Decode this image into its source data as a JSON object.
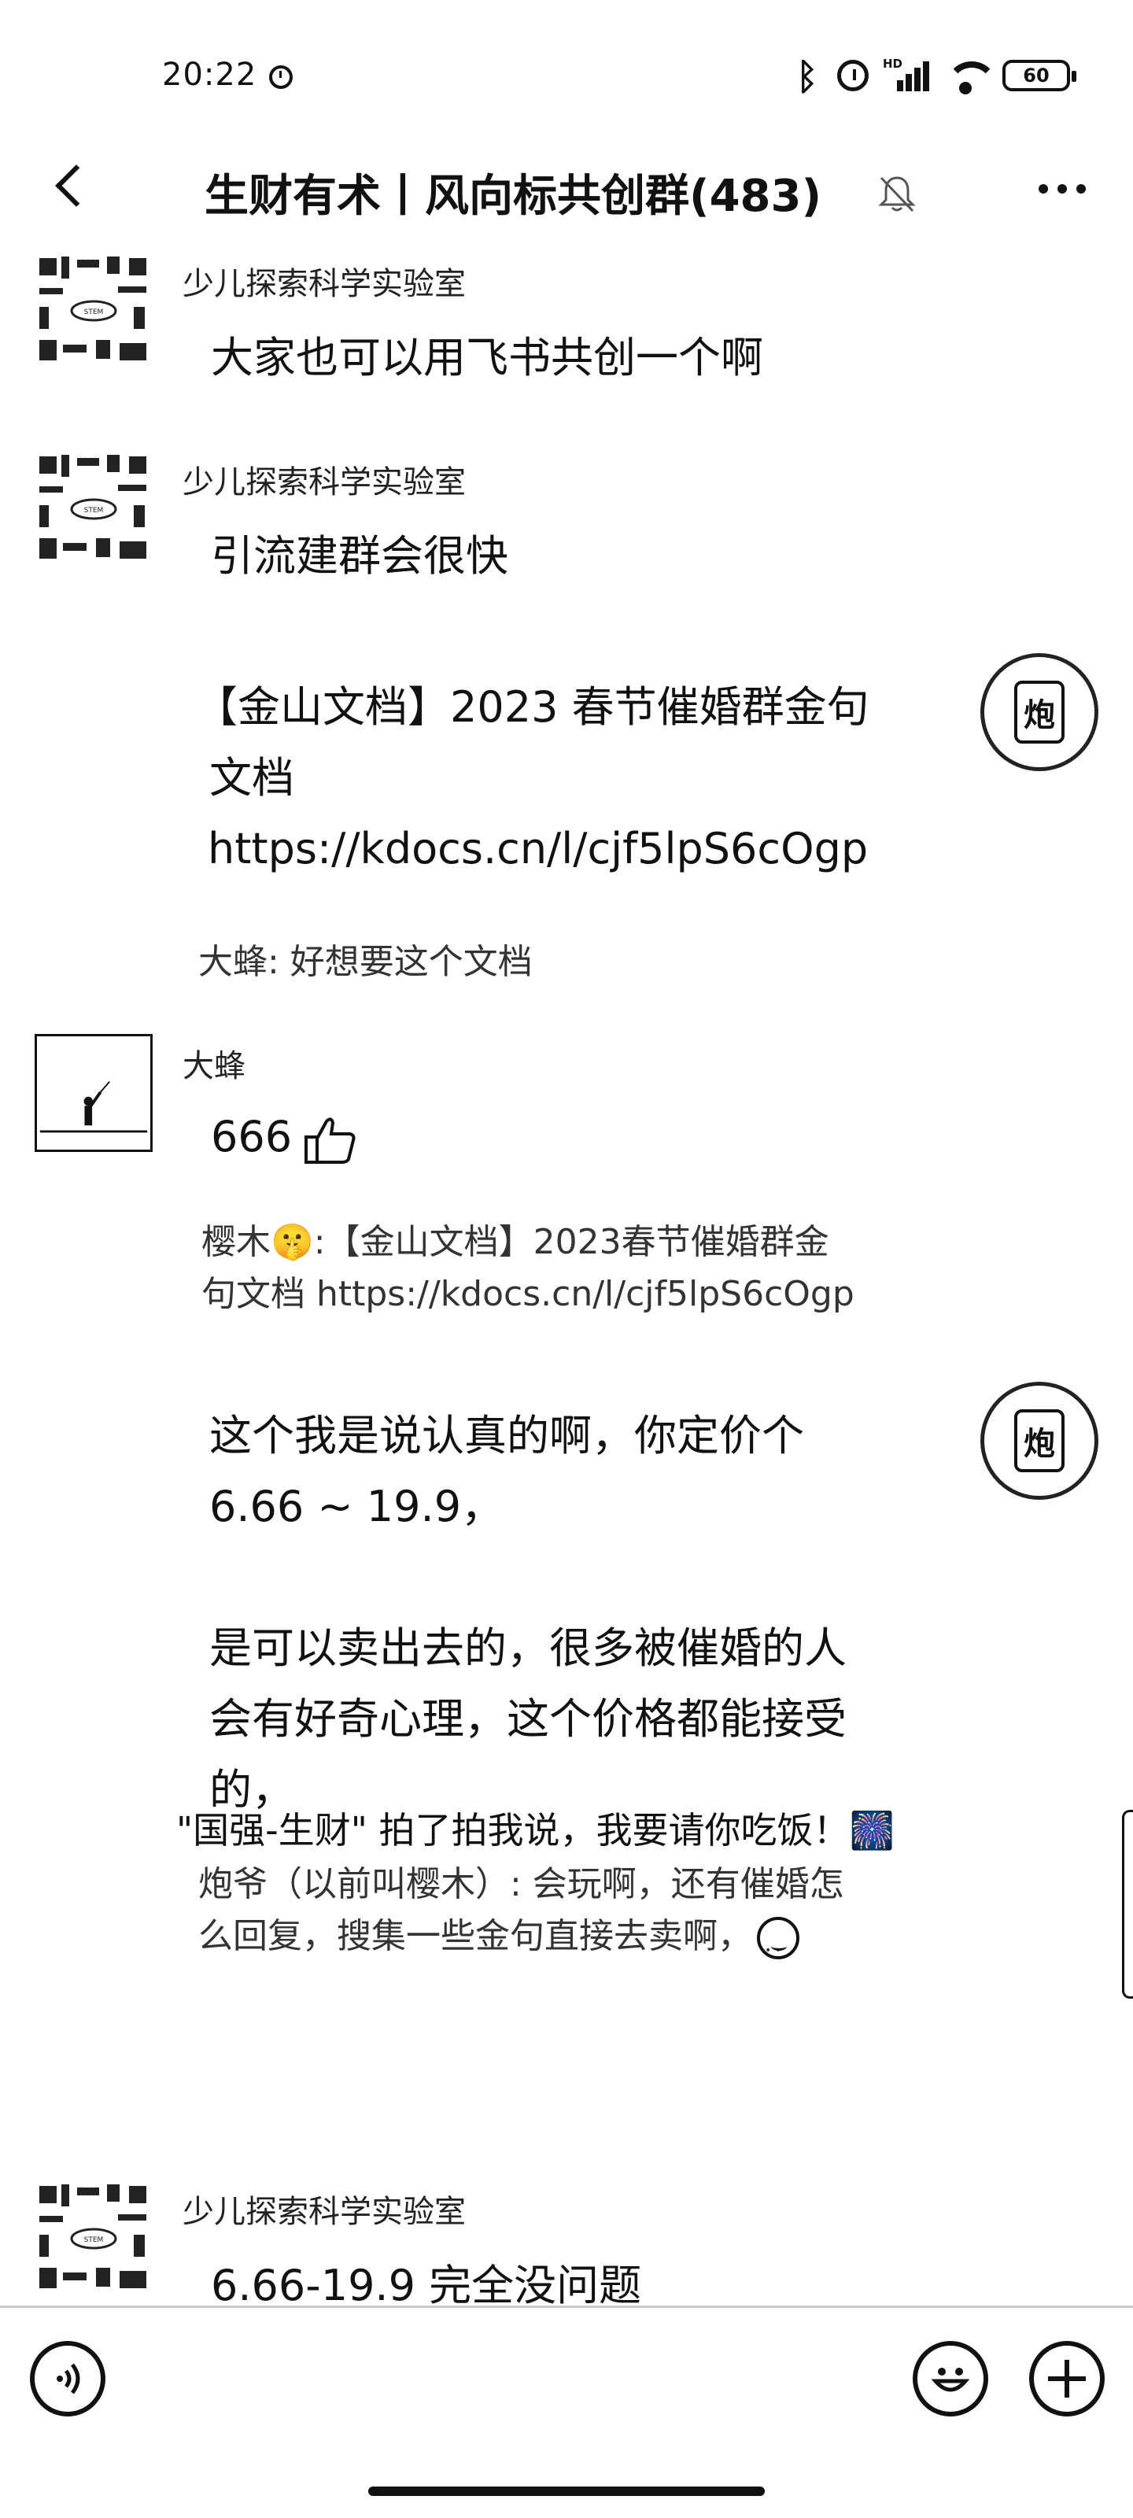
{
  "status_bar": {
    "time": "20:22",
    "battery": "60",
    "signal_label": "HD",
    "icons": [
      "alarm-icon",
      "bluetooth-icon",
      "alarm-clock-icon",
      "signal-icon",
      "wifi-icon",
      "battery-icon"
    ]
  },
  "header": {
    "back_icon": "chevron-left-icon",
    "title": "生财有术丨风向标共创群(483)",
    "mute_icon": "bell-muted-icon",
    "more_icon": "more-horizontal-icon"
  },
  "messages": {
    "m1": {
      "sender": "少儿探索科学实验室",
      "text": "大家也可以用飞书共创一个啊"
    },
    "m2": {
      "sender": "少儿探索科学实验室",
      "text": "引流建群会很快"
    },
    "m3": {
      "lines": [
        "【金山文档】2023 春节催婚群金句",
        "文档",
        "https://kdocs.cn/l/cjf5lpS6cOgp"
      ],
      "quote": "大蜂: 好想要这个文档"
    },
    "m4": {
      "sender": "大蜂",
      "text": "666",
      "quote_lines": [
        "樱木🤫:【金山文档】2023春节催婚群金",
        "句文档 https://kdocs.cn/l/cjf5lpS6cOgp"
      ]
    },
    "m5": {
      "lines": [
        "这个我是说认真的啊，你定价个",
        "6.66 ~ 19.9，",
        "",
        "是可以卖出去的，很多被催婚的人",
        "会有好奇心理，这个价格都能接受",
        "的，"
      ],
      "quote_lines": [
        "炮爷（以前叫樱木）: 会玩啊，还有催婚怎",
        "么回复，搜集一些金句直接去卖啊，"
      ]
    },
    "system": "\"国强-生财\" 拍了拍我说，我要请你吃饭！🎆",
    "m6": {
      "sender": "少儿探索科学实验室",
      "text": "6.66-19.9 完全没问题"
    }
  },
  "pao_avatar_char": "炮",
  "input_bar": {
    "voice_icon": "voice-icon",
    "emoji_icon": "emoji-icon",
    "plus_icon": "plus-icon"
  }
}
